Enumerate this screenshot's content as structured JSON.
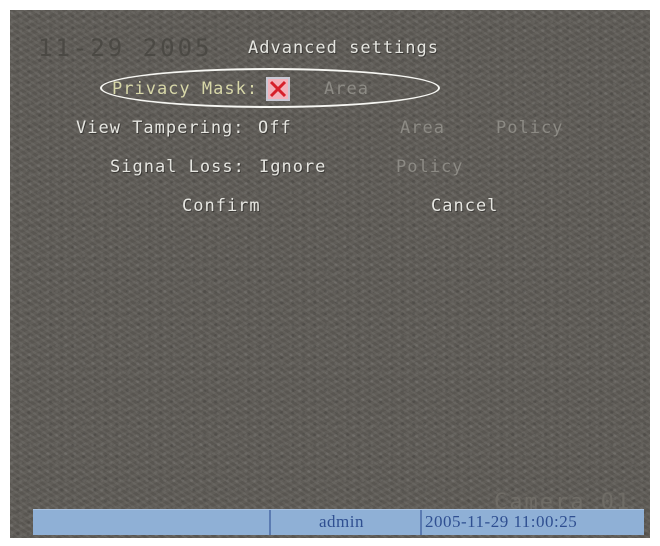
{
  "screen": {
    "ghost_date": "11-29 2005",
    "title": "Advanced settings",
    "camera_label": "Camera 01"
  },
  "privacy_mask": {
    "label": "Privacy Mask:",
    "checked": true,
    "area_label": "Area"
  },
  "view_tampering": {
    "label": "View Tampering:",
    "value": "Off",
    "area_label": "Area",
    "policy_label": "Policy"
  },
  "signal_loss": {
    "label": "Signal Loss:",
    "value": "Ignore",
    "policy_label": "Policy"
  },
  "actions": {
    "confirm_label": "Confirm",
    "cancel_label": "Cancel"
  },
  "status_bar": {
    "user": "admin",
    "datetime": "2005-11-29 11:00:25"
  },
  "colors": {
    "osd_text": "#e6e6e1",
    "disabled_text": "#8c8a84",
    "status_bar": "#8fb0d6",
    "status_text": "#2f4f91",
    "checkbox_fill": "#f2b2bb",
    "checkbox_mark": "#d6202a"
  },
  "icons": {
    "checkbox_mark": "x-mark-icon"
  }
}
